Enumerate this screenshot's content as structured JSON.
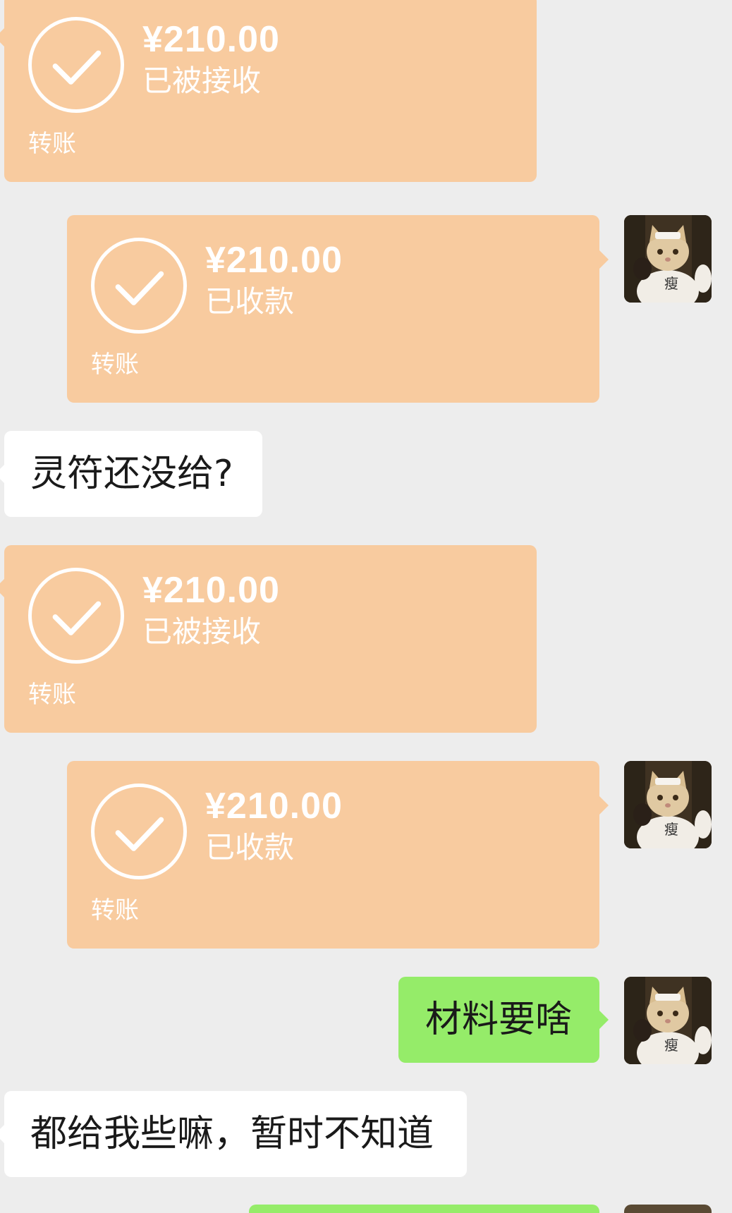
{
  "messages": [
    {
      "type": "transfer",
      "side": "left",
      "amount": "¥210.00",
      "status": "已被接收",
      "label": "转账"
    },
    {
      "type": "transfer",
      "side": "right",
      "amount": "¥210.00",
      "status": "已收款",
      "label": "转账"
    },
    {
      "type": "text",
      "side": "left",
      "text": "灵符还没给?"
    },
    {
      "type": "transfer",
      "side": "left",
      "amount": "¥210.00",
      "status": "已被接收",
      "label": "转账"
    },
    {
      "type": "transfer",
      "side": "right",
      "amount": "¥210.00",
      "status": "已收款",
      "label": "转账"
    },
    {
      "type": "text",
      "side": "right",
      "text": "材料要啥"
    },
    {
      "type": "text",
      "side": "left",
      "text": "都给我些嘛，暂时不知道"
    }
  ],
  "avatar": {
    "icon": "cat-avatar-icon",
    "badge_text": "瘦"
  },
  "colors": {
    "background": "#ededed",
    "transfer_card": "#f8cb9f",
    "own_bubble": "#95ec69",
    "other_bubble": "#ffffff"
  }
}
